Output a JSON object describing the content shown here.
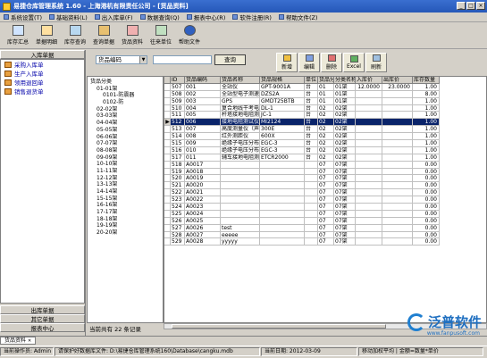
{
  "titlebar": {
    "title": "易捷仓库管理系统 1.60 - 上海港机有限责任公司 - [货品资料]"
  },
  "menu": [
    "系统设置(T)",
    "基础资料(L)",
    "出入库单(F)",
    "数据查询(Q)",
    "报表中心(R)",
    "软件注册(R)",
    "帮助文件(Z)"
  ],
  "toolbar": [
    "库存汇总",
    "单据明细",
    "库存查询",
    "查询单据",
    "货品资料",
    "往来单位",
    "帮助文件"
  ],
  "sidebar": {
    "top_group": "入库单据",
    "items": [
      "采购入库单",
      "生产入库单",
      "领用退回单",
      "销售退货单"
    ],
    "bottom_groups": [
      "出库单据",
      "其它单据",
      "报表中心"
    ]
  },
  "filter": {
    "field": "货品编码",
    "query_label": "查询"
  },
  "actions": [
    "新增",
    "编辑",
    "删除",
    "Excel",
    "刷新"
  ],
  "tree": {
    "nodes": [
      "货品分类",
      "01-01架",
      "0101-防震器",
      "0102-防",
      "02-02架",
      "03-03架",
      "04-04架",
      "05-05架",
      "06-06架",
      "07-07架",
      "08-08架",
      "09-09架",
      "10-10架",
      "11-11架",
      "12-12架",
      "13-13架",
      "14-14架",
      "15-15架",
      "16-16架",
      "17-17架",
      "18-18架",
      "19-19架",
      "20-20架"
    ]
  },
  "grid": {
    "headers": [
      "ID",
      "货品编码",
      "货品名称",
      "货品规格",
      "单位",
      "货品分类",
      "分类名称",
      "入库价",
      "出库价",
      "库存数量"
    ],
    "rows": [
      [
        "507",
        "001",
        "全站仪",
        "GPT-9001A",
        "台",
        "01",
        "01架",
        "12.0000",
        "23.0000",
        "1.00"
      ],
      [
        "508",
        "002",
        "全站型电子测速",
        "DZS2A",
        "台",
        "01",
        "01架",
        "",
        "",
        "8.00"
      ],
      [
        "509",
        "003",
        "GPS",
        "GMDT25BTB",
        "台",
        "01",
        "01架",
        "",
        "",
        "1.00"
      ],
      [
        "510",
        "004",
        "复合地线干考电",
        "DL-1",
        "台",
        "02",
        "02架",
        "",
        "",
        "1.00"
      ],
      [
        "511",
        "005",
        "杆塔接地电阻测",
        "JC-1",
        "台",
        "02",
        "02架",
        "",
        "",
        "1.00"
      ],
      [
        "512",
        "006",
        "接地电阻测试仪",
        "MI2124",
        "台",
        "02",
        "02架",
        "",
        "",
        "1.00"
      ],
      [
        "513",
        "007",
        "高度测量仪（声",
        "300E",
        "台",
        "02",
        "02架",
        "",
        "",
        "1.00"
      ],
      [
        "514",
        "008",
        "红外测距仪",
        "600X",
        "台",
        "02",
        "02架",
        "",
        "",
        "1.00"
      ],
      [
        "515",
        "009",
        "绝缘子电压分布",
        "EGC-3",
        "台",
        "02",
        "02架",
        "",
        "",
        "1.00"
      ],
      [
        "516",
        "010",
        "绝缘子电压分布",
        "EGC-3",
        "台",
        "02",
        "02架",
        "",
        "",
        "1.00"
      ],
      [
        "517",
        "011",
        "辅车接地电阻测",
        "ETCR2000",
        "台",
        "02",
        "02架",
        "",
        "",
        "1.00"
      ],
      [
        "518",
        "A0017",
        "",
        "",
        "",
        "07",
        "07架",
        "",
        "",
        "0.00"
      ],
      [
        "519",
        "A0018",
        "",
        "",
        "",
        "07",
        "07架",
        "",
        "",
        "0.00"
      ],
      [
        "520",
        "A0019",
        "",
        "",
        "",
        "07",
        "07架",
        "",
        "",
        "0.00"
      ],
      [
        "521",
        "A0020",
        "",
        "",
        "",
        "07",
        "07架",
        "",
        "",
        "0.00"
      ],
      [
        "522",
        "A0021",
        "",
        "",
        "",
        "07",
        "07架",
        "",
        "",
        "0.00"
      ],
      [
        "523",
        "A0022",
        "",
        "",
        "",
        "07",
        "07架",
        "",
        "",
        "0.00"
      ],
      [
        "524",
        "A0023",
        "",
        "",
        "",
        "07",
        "07架",
        "",
        "",
        "0.00"
      ],
      [
        "525",
        "A0024",
        "",
        "",
        "",
        "07",
        "07架",
        "",
        "",
        "0.00"
      ],
      [
        "526",
        "A0025",
        "",
        "",
        "",
        "07",
        "07架",
        "",
        "",
        "0.00"
      ],
      [
        "527",
        "A0026",
        "test",
        "",
        "",
        "07",
        "07架",
        "",
        "",
        "0.00"
      ],
      [
        "528",
        "A0027",
        "eeeee",
        "",
        "",
        "07",
        "07架",
        "",
        "",
        "0.00"
      ],
      [
        "529",
        "A0028",
        "yyyyy",
        "",
        "",
        "07",
        "07架",
        "",
        "",
        "0.00"
      ]
    ],
    "selected_index": 5
  },
  "record_count_text": "当前共有 22 条记录",
  "window_tab": "货品资料",
  "status": [
    "当前操作员: Admin",
    "请保护好数据库文件: D:\\易捷仓库管理系统160\\Database\\cangku.mdb",
    "当前日期: 2012-03-09",
    "移动加权平均 | 金额=数量*单价"
  ],
  "watermark": {
    "brand": "泛普软件",
    "url": "www.fanpusoft.com"
  },
  "colors": {
    "title_blue": "#2557b8",
    "selection": "#0a246a",
    "chrome": "#d4d0c8"
  }
}
